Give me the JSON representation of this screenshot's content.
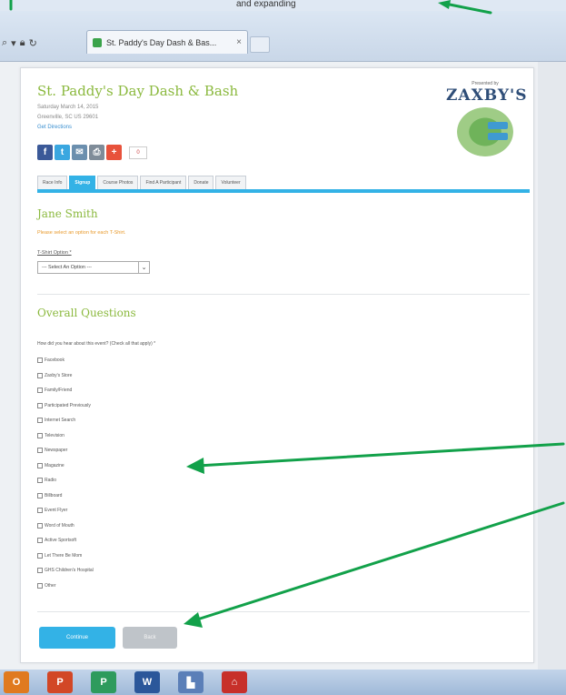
{
  "top_text": "and expanding",
  "browser": {
    "tab_title": "St. Paddy's Day Dash & Bas...",
    "tab_close": "×"
  },
  "event": {
    "title": "St. Paddy's Day Dash & Bash",
    "date": "Saturday March 14, 2015",
    "location": "Greenville, SC US 29601",
    "link": "Get Directions"
  },
  "logo": {
    "presented_by": "Presented by",
    "brand": "ZAXBY'S"
  },
  "share": {
    "count": "0"
  },
  "tabs": [
    {
      "label": "Race Info",
      "active": false
    },
    {
      "label": "Signup",
      "active": true
    },
    {
      "label": "Course Photos",
      "active": false
    },
    {
      "label": "Find A Participant",
      "active": false
    },
    {
      "label": "Donate",
      "active": false
    },
    {
      "label": "Volunteer",
      "active": false
    }
  ],
  "participant": {
    "name": "Jane Smith",
    "note": "Please select an option for each T-Shirt.",
    "size_label": "T-Shirt Option *",
    "select_value": "--- Select An Option ---"
  },
  "overall": {
    "heading": "Overall Questions",
    "question": "How did you hear about this event? (Check all that apply) *",
    "options": [
      "Facebook",
      "Zaxby's Store",
      "Family/Friend",
      "Participated Previously",
      "Internet Search",
      "Television",
      "Newspaper",
      "Magazine",
      "Radio",
      "Billboard",
      "Event Flyer",
      "Word of Mouth",
      "Active Sportsoft",
      "Let There Be Mom",
      "GHS Children's Hospital",
      "Other"
    ]
  },
  "buttons": {
    "continue": "Continue",
    "back": "Back"
  },
  "colors": {
    "accent_blue": "#33b2e6",
    "heading_green": "#8bb93e",
    "arrow_green": "#12a14a"
  }
}
